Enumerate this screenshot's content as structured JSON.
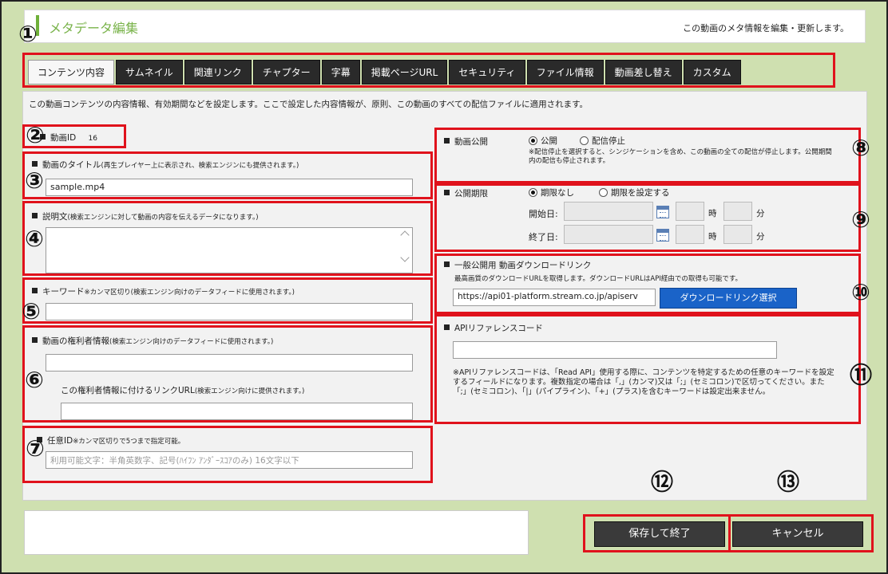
{
  "header": {
    "title": "メタデータ編集",
    "subtitle": "この動画のメタ情報を編集・更新します。"
  },
  "tabs": [
    {
      "label": "コンテンツ内容",
      "active": true
    },
    {
      "label": "サムネイル"
    },
    {
      "label": "関連リンク"
    },
    {
      "label": "チャプター"
    },
    {
      "label": "字幕"
    },
    {
      "label": "掲載ページURL"
    },
    {
      "label": "セキュリティ"
    },
    {
      "label": "ファイル情報"
    },
    {
      "label": "動画差し替え"
    },
    {
      "label": "カスタム"
    }
  ],
  "intro": "この動画コンテンツの内容情報、有効期間などを設定します。ここで設定した内容情報が、原則、この動画のすべての配信ファイルに適用されます。",
  "markers": [
    "①",
    "②",
    "③",
    "④",
    "⑤",
    "⑥",
    "⑦",
    "⑧",
    "⑨",
    "⑩",
    "⑪",
    "⑫",
    "⑬"
  ],
  "video_id": {
    "label": "動画ID",
    "value": "16"
  },
  "title_field": {
    "label": "動画のタイトル",
    "note": "(再生プレイヤー上に表示され、検索エンジンにも提供されます。)",
    "value": "sample.mp4"
  },
  "description": {
    "label": "説明文",
    "note": "(検索エンジンに対して動画の内容を伝えるデータになります。)",
    "value": ""
  },
  "keywords": {
    "label": "キーワード",
    "note": "※カンマ区切り(検索エンジン向けのデータフィードに使用されます。)",
    "value": ""
  },
  "rights": {
    "label": "動画の権利者情報",
    "note": "(検索エンジン向けのデータフィードに使用されます。)",
    "value": "",
    "link_label": "この権利者情報に付けるリンクURL",
    "link_note": "(検索エンジン向けに提供されます。)",
    "link_value": ""
  },
  "custom_id": {
    "label": "任意ID",
    "note": "※カンマ区切りで5つまで指定可能。",
    "placeholder": "利用可能文字：半角英数字、記号(ﾊｲﾌﾝ ｱﾝﾀﾞｰｽｺｱのみ) 16文字以下"
  },
  "publish": {
    "label": "動画公開",
    "option_public": "公開",
    "option_stop": "配信停止",
    "selected": "公開",
    "note": "※配信停止を選択すると、シンジケーションを含め、この動画の全ての配信が停止します。公開期間内の配信も停止されます。"
  },
  "period": {
    "label": "公開期限",
    "option_none": "期限なし",
    "option_set": "期限を設定する",
    "selected": "期限なし",
    "start_label": "開始日:",
    "end_label": "終了日:",
    "hour_label": "時",
    "minute_label": "分"
  },
  "download": {
    "label": "一般公開用 動画ダウンロードリンク",
    "note": "最高画質のダウンロードURLを取得します。ダウンロードURLはAPI経由での取得も可能です。",
    "url_value": "https://api01-platform.stream.co.jp/apiserv",
    "button": "ダウンロードリンク選択"
  },
  "api_ref": {
    "label": "APIリファレンスコード",
    "value": "",
    "note": "※APIリファレンスコードは、「Read API」使用する際に、コンテンツを特定するための任意のキーワードを設定するフィールドになります。複数指定の場合は「,」(カンマ)又は「;」(セミコロン)で区切ってください。また「;」(セミコロン)、「|」(パイプライン)、「+」(プラス)を含むキーワードは設定出来ません。"
  },
  "buttons": {
    "save": "保存して終了",
    "cancel": "キャンセル"
  },
  "colors": {
    "accent_green": "#79b34a",
    "highlight_red": "#e0121c",
    "button_blue": "#1a63c8",
    "background_green": "#cfe0b0"
  }
}
